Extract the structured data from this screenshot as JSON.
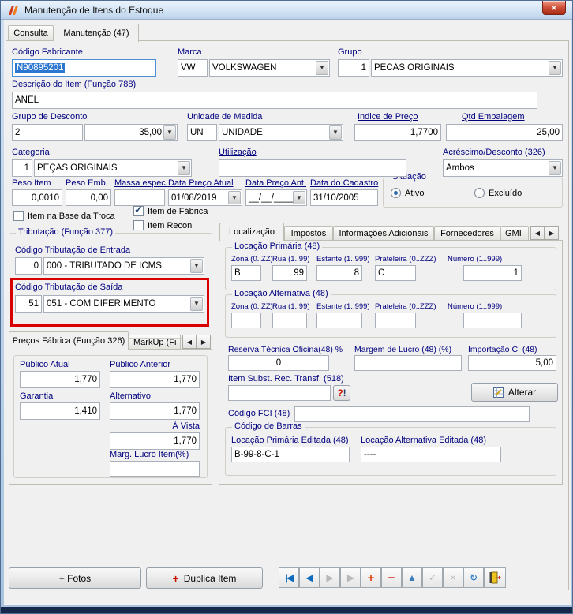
{
  "window": {
    "title": "Manutenção de Itens do Estoque",
    "close_glyph": "×"
  },
  "main_tabs": {
    "consulta": "Consulta",
    "manutencao": "Manutenção (47)"
  },
  "icons": {
    "dropdown_arrow": "▼",
    "check": "✓"
  },
  "fields": {
    "codigo_fabricante": {
      "label": "Código Fabricante",
      "value": "N90895201"
    },
    "marca": {
      "label": "Marca",
      "code": "VW",
      "name": "VOLKSWAGEN"
    },
    "grupo": {
      "label": "Grupo",
      "code": "1",
      "name": "PECAS ORIGINAIS"
    },
    "descricao_item": {
      "label": "Descrição do Item (Função 788)",
      "value": "ANEL"
    },
    "grupo_desconto": {
      "label": "Grupo de Desconto",
      "code": "2",
      "value": "35,00"
    },
    "unidade_medida": {
      "label": "Unidade de Medida",
      "code": "UN",
      "name": "UNIDADE"
    },
    "indice_preco": {
      "label": "Indice de Preço",
      "value": "1,7700"
    },
    "qtd_embalagem": {
      "label": "Qtd Embalagem",
      "value": "25,00"
    },
    "categoria": {
      "label": "Categoria",
      "code": "1",
      "name": "PEÇAS ORIGINAIS"
    },
    "utilizacao": {
      "label": "Utilização",
      "value": ""
    },
    "acrescimo_desconto": {
      "label": "Acréscimo/Desconto (326)",
      "value": "Ambos"
    },
    "peso_item": {
      "label": "Peso Item",
      "value": "0,0010"
    },
    "peso_emb": {
      "label": "Peso Emb.",
      "value": "0,00"
    },
    "massa_espec": {
      "label": "Massa espec.",
      "value": ""
    },
    "data_preco_atual": {
      "label": "Data Preço Atual",
      "value": "01/08/2019"
    },
    "data_preco_ant": {
      "label": "Data Preço Ant.",
      "value": "__/__/____"
    },
    "data_cadastro": {
      "label": "Data do Cadastro",
      "value": "31/10/2005"
    }
  },
  "situacao": {
    "title": "Situação",
    "options": [
      {
        "label": "Ativo",
        "selected": true
      },
      {
        "label": "Excluído",
        "selected": false
      }
    ]
  },
  "checks": [
    {
      "label": "Item na Base da Troca",
      "checked": false
    },
    {
      "label": "Item de Fábrica",
      "checked": true
    },
    {
      "label": "Item Recon",
      "checked": false
    }
  ],
  "tributacao": {
    "title": "Tributação (Função 377)",
    "entrada_label": "Código Tributação de Entrada",
    "entrada_code": "0",
    "entrada_value": "000 - TRIBUTADO DE ICMS",
    "saida_label": "Código Tributação de Saída",
    "saida_code": "51",
    "saida_value": "051 - COM DIFERIMENTO"
  },
  "precos": {
    "tab_active": "Preços Fábrica (Função 326)",
    "tab_markup": "MarkUp (Fi",
    "publico_atual_label": "Público Atual",
    "publico_atual": "1,770",
    "publico_anterior_label": "Público Anterior",
    "publico_anterior": "1,770",
    "garantia_label": "Garantia",
    "garantia": "1,410",
    "alternativo_label": "Alternativo",
    "alternativo": "1,770",
    "a_vista_label": "À Vista",
    "a_vista": "1,770",
    "marg_lucro_label": "Marg. Lucro Item(%)",
    "marg_lucro": ""
  },
  "detail_tabs": {
    "localizacao": "Localização",
    "impostos": "Impostos",
    "info_adicionais": "Informações Adicionais",
    "fornecedores": "Fornecedores",
    "gmi": "GMI"
  },
  "localizacao": {
    "col_labels": {
      "zona": "Zona (0..ZZ)",
      "rua": "Rua (1..99)",
      "estante": "Estante (1..999)",
      "prateleira": "Prateleira (0..ZZZ)",
      "numero": "Número (1..999)"
    },
    "primaria": {
      "title": "Locação Primária (48)",
      "zona": "B",
      "rua": "99",
      "estante": "8",
      "prateleira": "C",
      "numero": "1"
    },
    "alternativa": {
      "title": "Locação Alternativa (48)",
      "zona": "",
      "rua": "",
      "estante": "",
      "prateleira": "",
      "numero": ""
    },
    "reserva_label": "Reserva Técnica Oficina(48) %",
    "reserva": "0",
    "margem_label": "Margem de Lucro (48) (%)",
    "margem": "",
    "importacao_label": "Importação CI (48)",
    "importacao": "5,00",
    "item_subst_label": "Item Subst. Rec. Transf. (518)",
    "item_subst": "",
    "help_q": "?",
    "help_bang": "!",
    "alterar_label": "Alterar",
    "codigo_fci_label": "Código FCI (48)",
    "codigo_fci": "",
    "barras": {
      "title": "Código de Barras",
      "primaria_label": "Locação Primária Editada (48)",
      "primaria": "B-99-8-C-1",
      "alternativa_label": "Locação Alternativa Editada (48)",
      "alternativa": "----"
    }
  },
  "bottom": {
    "fotos": "+ Fotos",
    "duplica_icon": "+",
    "duplica": "Duplica Item"
  },
  "navigator": [
    {
      "name": "first",
      "glyph": "|◀",
      "enabled": true
    },
    {
      "name": "prior",
      "glyph": "◀",
      "enabled": true
    },
    {
      "name": "next",
      "glyph": "▶",
      "enabled": false
    },
    {
      "name": "last",
      "glyph": "▶|",
      "enabled": false
    },
    {
      "name": "insert",
      "glyph": "+",
      "enabled": true
    },
    {
      "name": "delete",
      "glyph": "−",
      "enabled": true
    },
    {
      "name": "edit",
      "glyph": "▲",
      "enabled": true
    },
    {
      "name": "post",
      "glyph": "✓",
      "enabled": false
    },
    {
      "name": "cancel",
      "glyph": "×",
      "enabled": false
    },
    {
      "name": "refresh",
      "glyph": "↻",
      "enabled": true
    }
  ],
  "spin": {
    "left": "◀",
    "right": "▶"
  },
  "colors": {
    "label_navy": "#00007f",
    "annotation_red": "#d90000",
    "selection_blue": "#2e77d0",
    "close_red": "#a92a12"
  }
}
